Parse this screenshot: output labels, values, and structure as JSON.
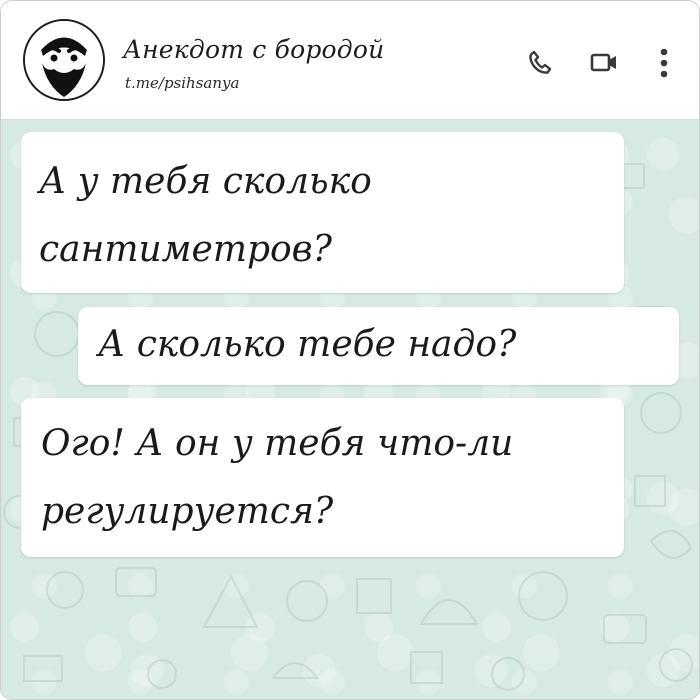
{
  "header": {
    "channel_title": "Анекдот с бородой",
    "channel_link": "t.me/psihsanya",
    "icons": {
      "avatar": "bearded-face-avatar",
      "call": "phone-icon",
      "video": "video-camera-icon",
      "menu": "more-vertical-icon"
    }
  },
  "messages": [
    {
      "text": "А у тебя сколько\nсантиметров?"
    },
    {
      "text": "А сколько тебе надо?"
    },
    {
      "text": "Ого! А он у тебя что-ли\nрегулируется?"
    }
  ],
  "colors": {
    "header_background": "#ffffff",
    "chat_background": "#d6e9e3",
    "bubble_background": "#ffffff",
    "text": "#1a1a1a",
    "icon": "#3a3a3a"
  }
}
